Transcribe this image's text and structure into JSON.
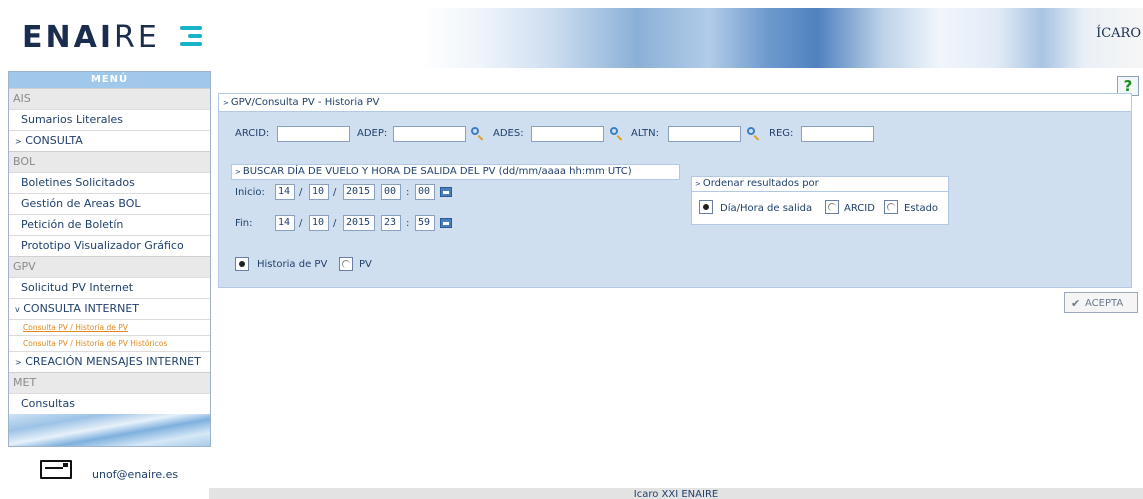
{
  "header": {
    "logo_main": "ENAI",
    "logo_tail": "RE",
    "brand_right": "ÍCARO"
  },
  "sidebar": {
    "menu_title": "MENÚ",
    "sections": [
      {
        "title": "AIS",
        "items": [
          "Sumarios Literales",
          "CONSULTA"
        ]
      },
      {
        "title": "BOL",
        "items": [
          "Boletines Solicitados",
          "Gestión de Areas BOL",
          "Petición de Boletín",
          "Prototipo Visualizador Gráfico"
        ]
      },
      {
        "title": "GPV",
        "items": [
          "Solicitud PV Internet",
          "CONSULTA INTERNET",
          "Consulta PV / Historia de PV",
          "Consulta PV / Historia de PV Históricos",
          "CREACIÓN MENSAJES INTERNET"
        ]
      },
      {
        "title": "MET",
        "items": [
          "Consultas"
        ]
      }
    ],
    "email": "unof@enaire.es"
  },
  "main": {
    "help": "?",
    "breadcrumb": "GPV/Consulta PV - Historia PV",
    "filters": {
      "arcid": "ARCID:",
      "adep": "ADEP:",
      "ades": "ADES:",
      "altn": "ALTN:",
      "reg": "REG:"
    },
    "date_box": {
      "title": "BUSCAR DÍA DE VUELO Y HORA DE SALIDA DEL PV (dd/mm/aaaa hh:mm UTC)",
      "inicio_label": "Inicio:",
      "fin_label": "Fin:",
      "inicio": {
        "d": "14",
        "m": "10",
        "y": "2015",
        "h": "00",
        "min": "00"
      },
      "fin": {
        "d": "14",
        "m": "10",
        "y": "2015",
        "h": "23",
        "min": "59"
      },
      "sep_date": "/",
      "sep_time": ":"
    },
    "order_box": {
      "title": "Ordenar resultados por",
      "options": [
        "Día/Hora de salida",
        "ARCID",
        "Estado"
      ],
      "selected": "Día/Hora de salida"
    },
    "mode": {
      "options": [
        "Historia de PV",
        "PV"
      ],
      "selected": "Historia de PV"
    },
    "accept": "ACEPTA"
  },
  "footer": "Icaro XXI ENAIRE"
}
